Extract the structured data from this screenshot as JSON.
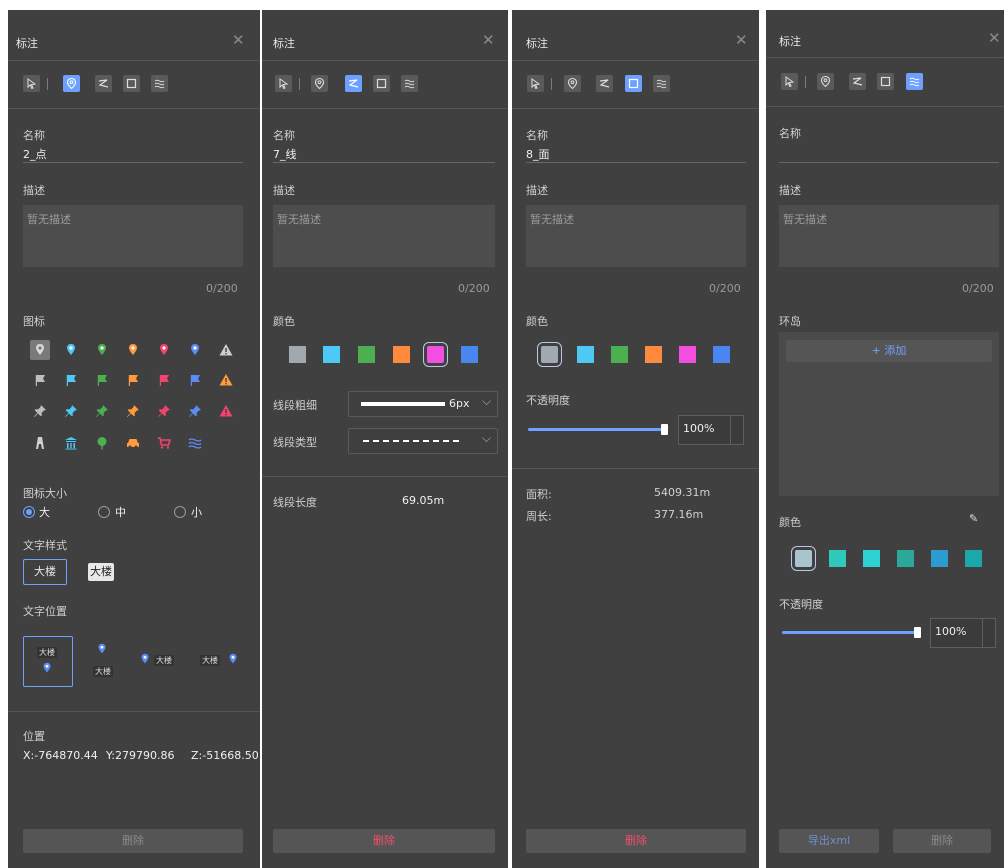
{
  "panels": {
    "point": {
      "title": "标注",
      "name_label": "名称",
      "name_value": "2_点",
      "desc_label": "描述",
      "desc_placeholder": "暂无描述",
      "desc_count": "0/200",
      "icon_label": "图标",
      "icon_size_label": "图标大小",
      "size_options": [
        "大",
        "中",
        "小"
      ],
      "size_selected": "大",
      "text_style_label": "文字样式",
      "text_styles": [
        "大楼",
        "大楼"
      ],
      "text_pos_label": "文字位置",
      "text_pos_options": [
        "大楼",
        "大楼",
        "大楼",
        "大楼"
      ],
      "position_label": "位置",
      "position_x": "X:-764870.44",
      "position_y": "Y:279790.86",
      "position_z": "Z:-51668.50",
      "delete_label": "删除"
    },
    "line": {
      "title": "标注",
      "name_label": "名称",
      "name_value": "7_线",
      "desc_label": "描述",
      "desc_placeholder": "暂无描述",
      "desc_count": "0/200",
      "color_label": "颜色",
      "colors": [
        "#a0a8b0",
        "#4dc9f6",
        "#4caf50",
        "#ff8a3d",
        "#f24ee0",
        "#4a86f0"
      ],
      "width_label": "线段粗细",
      "width_value": "6px",
      "type_label": "线段类型",
      "length_label": "线段长度",
      "length_value": "69.05m",
      "delete_label": "删除"
    },
    "polygon": {
      "title": "标注",
      "name_label": "名称",
      "name_value": "8_面",
      "desc_label": "描述",
      "desc_placeholder": "暂无描述",
      "desc_count": "0/200",
      "color_label": "颜色",
      "colors": [
        "#a0a8b0",
        "#4dc9f6",
        "#4caf50",
        "#ff8a3d",
        "#f24ee0",
        "#4a86f0"
      ],
      "opacity_label": "不透明度",
      "opacity_value": "100%",
      "area_label": "面积:",
      "area_value": "5409.31m",
      "perimeter_label": "周长:",
      "perimeter_value": "377.16m",
      "delete_label": "删除"
    },
    "water": {
      "title": "标注",
      "name_label": "名称",
      "name_value": "",
      "desc_label": "描述",
      "desc_placeholder": "暂无描述",
      "desc_count": "0/200",
      "island_label": "环岛",
      "add_label": "+ 添加",
      "color_label": "颜色",
      "colors": [
        "#a9c4cc",
        "#2ec9b8",
        "#2fd2d2",
        "#2aa89a",
        "#2b9bd0",
        "#1aa8a8"
      ],
      "opacity_label": "不透明度",
      "opacity_value": "100%",
      "export_label": "导出xml",
      "delete_label": "删除"
    }
  }
}
